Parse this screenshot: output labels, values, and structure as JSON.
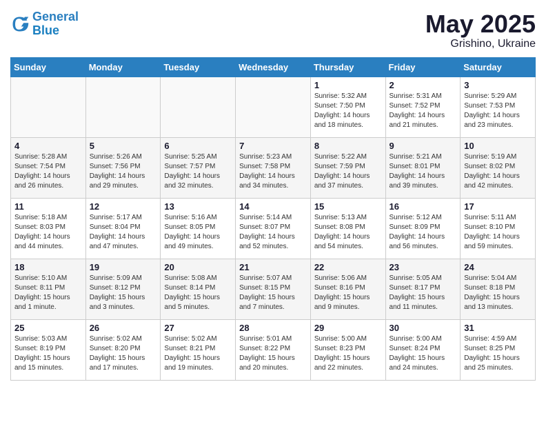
{
  "logo": {
    "line1": "General",
    "line2": "Blue"
  },
  "title": "May 2025",
  "subtitle": "Grishino, Ukraine",
  "days_of_week": [
    "Sunday",
    "Monday",
    "Tuesday",
    "Wednesday",
    "Thursday",
    "Friday",
    "Saturday"
  ],
  "weeks": [
    [
      {
        "day": "",
        "info": ""
      },
      {
        "day": "",
        "info": ""
      },
      {
        "day": "",
        "info": ""
      },
      {
        "day": "",
        "info": ""
      },
      {
        "day": "1",
        "info": "Sunrise: 5:32 AM\nSunset: 7:50 PM\nDaylight: 14 hours\nand 18 minutes."
      },
      {
        "day": "2",
        "info": "Sunrise: 5:31 AM\nSunset: 7:52 PM\nDaylight: 14 hours\nand 21 minutes."
      },
      {
        "day": "3",
        "info": "Sunrise: 5:29 AM\nSunset: 7:53 PM\nDaylight: 14 hours\nand 23 minutes."
      }
    ],
    [
      {
        "day": "4",
        "info": "Sunrise: 5:28 AM\nSunset: 7:54 PM\nDaylight: 14 hours\nand 26 minutes."
      },
      {
        "day": "5",
        "info": "Sunrise: 5:26 AM\nSunset: 7:56 PM\nDaylight: 14 hours\nand 29 minutes."
      },
      {
        "day": "6",
        "info": "Sunrise: 5:25 AM\nSunset: 7:57 PM\nDaylight: 14 hours\nand 32 minutes."
      },
      {
        "day": "7",
        "info": "Sunrise: 5:23 AM\nSunset: 7:58 PM\nDaylight: 14 hours\nand 34 minutes."
      },
      {
        "day": "8",
        "info": "Sunrise: 5:22 AM\nSunset: 7:59 PM\nDaylight: 14 hours\nand 37 minutes."
      },
      {
        "day": "9",
        "info": "Sunrise: 5:21 AM\nSunset: 8:01 PM\nDaylight: 14 hours\nand 39 minutes."
      },
      {
        "day": "10",
        "info": "Sunrise: 5:19 AM\nSunset: 8:02 PM\nDaylight: 14 hours\nand 42 minutes."
      }
    ],
    [
      {
        "day": "11",
        "info": "Sunrise: 5:18 AM\nSunset: 8:03 PM\nDaylight: 14 hours\nand 44 minutes."
      },
      {
        "day": "12",
        "info": "Sunrise: 5:17 AM\nSunset: 8:04 PM\nDaylight: 14 hours\nand 47 minutes."
      },
      {
        "day": "13",
        "info": "Sunrise: 5:16 AM\nSunset: 8:05 PM\nDaylight: 14 hours\nand 49 minutes."
      },
      {
        "day": "14",
        "info": "Sunrise: 5:14 AM\nSunset: 8:07 PM\nDaylight: 14 hours\nand 52 minutes."
      },
      {
        "day": "15",
        "info": "Sunrise: 5:13 AM\nSunset: 8:08 PM\nDaylight: 14 hours\nand 54 minutes."
      },
      {
        "day": "16",
        "info": "Sunrise: 5:12 AM\nSunset: 8:09 PM\nDaylight: 14 hours\nand 56 minutes."
      },
      {
        "day": "17",
        "info": "Sunrise: 5:11 AM\nSunset: 8:10 PM\nDaylight: 14 hours\nand 59 minutes."
      }
    ],
    [
      {
        "day": "18",
        "info": "Sunrise: 5:10 AM\nSunset: 8:11 PM\nDaylight: 15 hours\nand 1 minute."
      },
      {
        "day": "19",
        "info": "Sunrise: 5:09 AM\nSunset: 8:12 PM\nDaylight: 15 hours\nand 3 minutes."
      },
      {
        "day": "20",
        "info": "Sunrise: 5:08 AM\nSunset: 8:14 PM\nDaylight: 15 hours\nand 5 minutes."
      },
      {
        "day": "21",
        "info": "Sunrise: 5:07 AM\nSunset: 8:15 PM\nDaylight: 15 hours\nand 7 minutes."
      },
      {
        "day": "22",
        "info": "Sunrise: 5:06 AM\nSunset: 8:16 PM\nDaylight: 15 hours\nand 9 minutes."
      },
      {
        "day": "23",
        "info": "Sunrise: 5:05 AM\nSunset: 8:17 PM\nDaylight: 15 hours\nand 11 minutes."
      },
      {
        "day": "24",
        "info": "Sunrise: 5:04 AM\nSunset: 8:18 PM\nDaylight: 15 hours\nand 13 minutes."
      }
    ],
    [
      {
        "day": "25",
        "info": "Sunrise: 5:03 AM\nSunset: 8:19 PM\nDaylight: 15 hours\nand 15 minutes."
      },
      {
        "day": "26",
        "info": "Sunrise: 5:02 AM\nSunset: 8:20 PM\nDaylight: 15 hours\nand 17 minutes."
      },
      {
        "day": "27",
        "info": "Sunrise: 5:02 AM\nSunset: 8:21 PM\nDaylight: 15 hours\nand 19 minutes."
      },
      {
        "day": "28",
        "info": "Sunrise: 5:01 AM\nSunset: 8:22 PM\nDaylight: 15 hours\nand 20 minutes."
      },
      {
        "day": "29",
        "info": "Sunrise: 5:00 AM\nSunset: 8:23 PM\nDaylight: 15 hours\nand 22 minutes."
      },
      {
        "day": "30",
        "info": "Sunrise: 5:00 AM\nSunset: 8:24 PM\nDaylight: 15 hours\nand 24 minutes."
      },
      {
        "day": "31",
        "info": "Sunrise: 4:59 AM\nSunset: 8:25 PM\nDaylight: 15 hours\nand 25 minutes."
      }
    ]
  ]
}
